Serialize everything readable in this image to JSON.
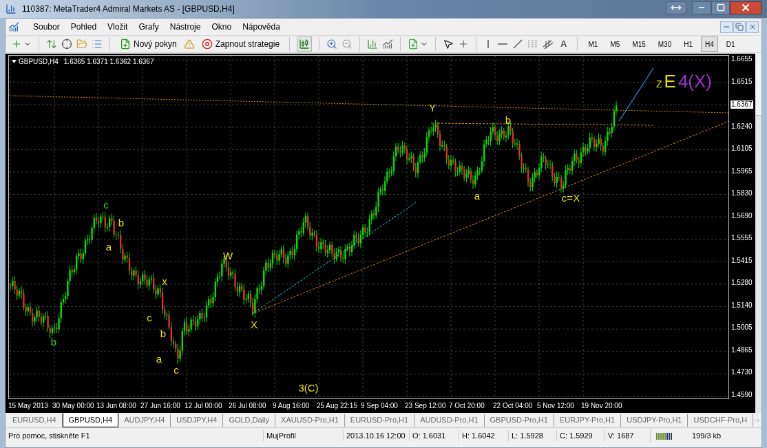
{
  "window": {
    "title": "110387: MetaTrader4 Admiral Markets AS - [GBPUSD,H4]"
  },
  "menu": [
    "Soubor",
    "Pohled",
    "Vložit",
    "Grafy",
    "Nástroje",
    "Okno",
    "Nápověda"
  ],
  "toolbar": {
    "new_order": "Nový pokyn",
    "strategies": "Zapnout strategie",
    "text_tool": "A",
    "timeframes": [
      {
        "label": "M1",
        "selected": false
      },
      {
        "label": "M5",
        "selected": false
      },
      {
        "label": "M15",
        "selected": false
      },
      {
        "label": "M30",
        "selected": false
      },
      {
        "label": "H1",
        "selected": false
      },
      {
        "label": "H4",
        "selected": true
      },
      {
        "label": "D1",
        "selected": false
      }
    ]
  },
  "chart": {
    "symbol": "GBPUSD,H4",
    "quotes": "1.6365 1.6371 1.6362 1.6367",
    "current_price": "1.6367",
    "price_axis": [
      "1.6655",
      "1.6515",
      "1.6240",
      "1.6105",
      "1.5965",
      "1.5830",
      "1.5690",
      "1.5555",
      "1.5415",
      "1.5280",
      "1.5140",
      "1.5005",
      "1.4865",
      "1.4730",
      "1.4590"
    ],
    "time_axis": [
      "15 May 2013",
      "30 May 00:00",
      "13 Jun 08:00",
      "27 Jun 16:00",
      "12 Jul 00:00",
      "26 Jul 08:00",
      "9 Aug 16:00",
      "25 Aug 22:15",
      "9 Sep 04:00",
      "23 Sep 12:00",
      "7 Oct 20:00",
      "22 Oct 04:00",
      "5 Nov 12:00",
      "19 Nov 20:00"
    ],
    "wave_labels": [
      {
        "text": "b",
        "color": "#32cd32"
      },
      {
        "text": "c",
        "color": "#32cd32"
      },
      {
        "text": "b",
        "color": "#e8e000"
      },
      {
        "text": "a",
        "color": "#e8e000"
      },
      {
        "text": "x",
        "color": "#e8e000"
      },
      {
        "text": "c",
        "color": "#e8e000"
      },
      {
        "text": "b",
        "color": "#e8e000"
      },
      {
        "text": "a",
        "color": "#e8e000"
      },
      {
        "text": "c",
        "color": "#e8e000"
      },
      {
        "text": "W",
        "color": "#e8e000"
      },
      {
        "text": "X",
        "color": "#e8e000"
      },
      {
        "text": "3(C)",
        "color": "#e8e000"
      },
      {
        "text": "Y",
        "color": "#e8e000"
      },
      {
        "text": "b",
        "color": "#e8e000"
      },
      {
        "text": "a",
        "color": "#e8e000"
      },
      {
        "text": "c=X",
        "color": "#e8e000"
      }
    ],
    "projection": [
      {
        "text": "Z",
        "color": "#e8e000"
      },
      {
        "text": "E",
        "color": "#e8e000"
      },
      {
        "text": "4(X)",
        "color": "#9b30d0"
      }
    ]
  },
  "tabs": [
    {
      "label": "EURUSD,H4",
      "selected": false
    },
    {
      "label": "GBPUSD,H4",
      "selected": true
    },
    {
      "label": "AUDJPY,H4",
      "selected": false
    },
    {
      "label": "USDJPY,H4",
      "selected": false
    },
    {
      "label": "GOLD,Daily",
      "selected": false
    },
    {
      "label": "XAUUSD-Pro,H1",
      "selected": false
    },
    {
      "label": "EURUSD-Pro,H1",
      "selected": false
    },
    {
      "label": "AUDUSD-Pro,H1",
      "selected": false
    },
    {
      "label": "GBPUSD-Pro,H1",
      "selected": false
    },
    {
      "label": "EURJPY-Pro,H1",
      "selected": false
    },
    {
      "label": "USDJPY-Pro,H1",
      "selected": false
    },
    {
      "label": "USDCHF-Pro,H",
      "selected": false
    }
  ],
  "status_bar": {
    "help": "Pro pomoc, stiskněte F1",
    "profile": "MujProfil",
    "time": "2013.10.16 12:00",
    "open": "O: 1.6031",
    "high": "H: 1.6042",
    "low": "L: 1.5928",
    "close": "C: 1.5929",
    "volume": "V: 1687",
    "traffic": "199/3 kb"
  }
}
